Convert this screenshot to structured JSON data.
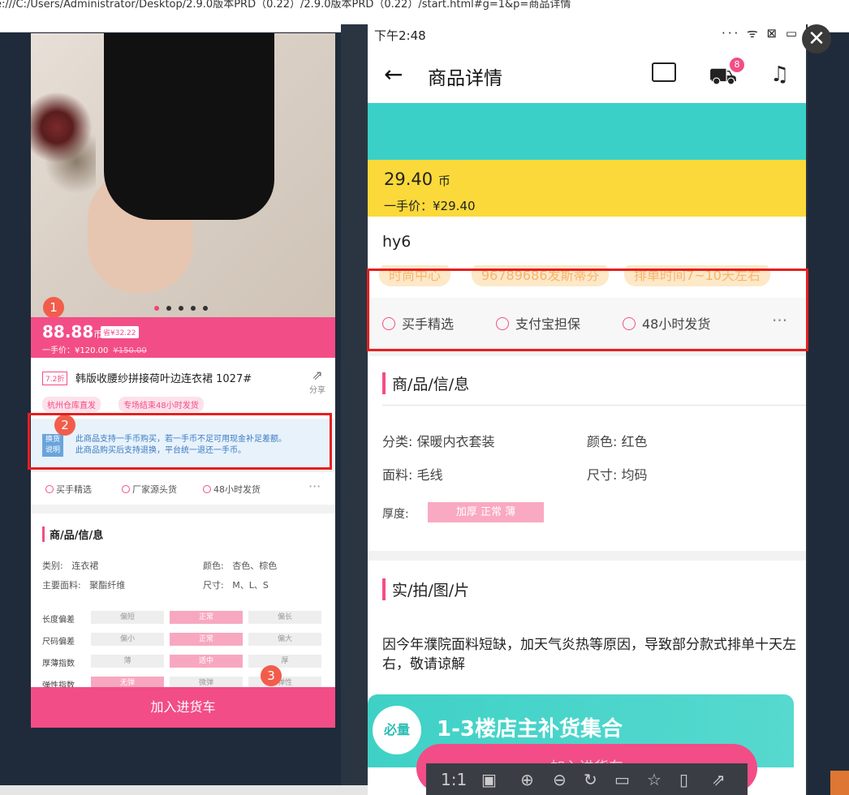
{
  "browser": {
    "url": "e:///C:/Users/Administrator/Desktop/2.9.0版本PRD（0.22）/2.9.0版本PRD（0.22）/start.html#g=1&p=商品详情"
  },
  "left_phone": {
    "markers": [
      "1",
      "2",
      "3"
    ],
    "price": "88.88",
    "price_unit": "币",
    "save_badge": "省¥32.22",
    "one_hand": "一手价：¥120.00",
    "original": "¥150.00",
    "discount": "7.2折",
    "title": "韩版收腰纱拼接荷叶边连衣裙 1027#",
    "share": "分享",
    "tags": [
      "杭州仓库直发",
      "专场结束48小时发货"
    ],
    "notice_badge": "换货说明",
    "notice_line1": "此商品支持一手币购买，若一手币不足可用现金补足差额。",
    "notice_line2": "此商品购买后支持退换，平台统一退还一手币。",
    "features": [
      "买手精选",
      "厂家源头货",
      "48小时发货"
    ],
    "more": "···",
    "section": "商/品/信/息",
    "kv": [
      {
        "label": "类别:",
        "value": "连衣裙"
      },
      {
        "label": "颜色:",
        "value": "杏色、棕色"
      },
      {
        "label": "主要面料:",
        "value": "聚酯纤维"
      },
      {
        "label": "尺寸:",
        "value": "M、L、S"
      }
    ],
    "grid": [
      {
        "label": "长度偏差",
        "cells": [
          "偏短",
          "正常",
          "偏长"
        ],
        "active": 1
      },
      {
        "label": "尺码偏差",
        "cells": [
          "偏小",
          "正常",
          "偏大"
        ],
        "active": 1
      },
      {
        "label": "厚薄指数",
        "cells": [
          "薄",
          "适中",
          "厚"
        ],
        "active": 1
      },
      {
        "label": "弹性指数",
        "cells": [
          "无弹",
          "微弹",
          "弹性"
        ],
        "active": 0
      }
    ],
    "cart": "加入进货车"
  },
  "right_phone": {
    "time": "下午2:48",
    "status_icons": "··· ᯤ ⊠ ▭",
    "nav_title": "商品详情",
    "cart_count": "8",
    "price": "29.40",
    "price_unit": "币",
    "one_hand": "一手价：¥29.40",
    "name": "hy6",
    "tags": [
      "时尚中心",
      "96789686发斯蒂芬",
      "排单时间7~10天左右"
    ],
    "features": [
      "买手精选",
      "支付宝担保",
      "48小时发货"
    ],
    "more": "···",
    "section_info": "商/品/信/息",
    "kv": [
      {
        "text": "分类: 保暖内衣套装"
      },
      {
        "text": "颜色: 红色"
      },
      {
        "text": "面料: 毛线"
      },
      {
        "text": "尺寸: 均码"
      }
    ],
    "thickness_label": "厚度:",
    "thickness_options": "加厚 正常 薄",
    "section_photos": "实/拍/图/片",
    "description": "因今年濮院面料短缺，加天气炎热等原因，导致部分款式排单十天左右，敬请谅解",
    "banner_text": "1-3楼店主补货集合",
    "banner_seal": "必量",
    "cart": "加入进货车"
  },
  "viewer": {
    "ratio": "1:1"
  },
  "close": "✕"
}
